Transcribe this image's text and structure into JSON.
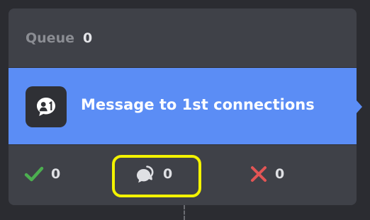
{
  "queue": {
    "label": "Queue",
    "count": "0"
  },
  "action": {
    "title": "Message to 1st connections",
    "icon": "message-first-connection-icon",
    "accent_color": "#5b8df5"
  },
  "stats": {
    "success": {
      "icon": "checkmark-icon",
      "count": "0",
      "color": "#4caf50"
    },
    "replies": {
      "icon": "chat-bubbles-icon",
      "count": "0",
      "color": "#dfe0e4"
    },
    "failed": {
      "icon": "cross-icon",
      "count": "0",
      "color": "#e25555"
    }
  },
  "highlight": {
    "color": "#f3f300"
  }
}
